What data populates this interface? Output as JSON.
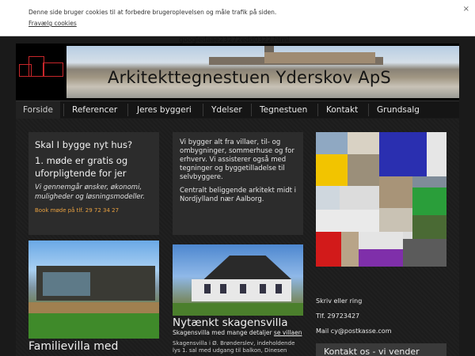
{
  "cookie": {
    "message": "Denne side bruger cookies til at forbedre brugeroplevelsen og måle trafik på siden.",
    "link": "Fravælg cookies",
    "close": "×"
  },
  "google_id": "googledaae23272edd0322.html",
  "header": {
    "title": "Arkitekttegnestuen Yderskov ApS"
  },
  "nav": {
    "items": [
      "Forside",
      "Referencer",
      "Jeres byggeri",
      "Ydelser",
      "Tegnestuen",
      "Kontakt",
      "Grundsalg"
    ]
  },
  "box1": {
    "heading": "Skal I bygge nyt hus?",
    "offer": "1. møde er gratis og uforpligtende for jer",
    "italic": "Vi gennemgår ønsker, økonomi, muligheder og løsningsmodeller.",
    "book": "Book møde på tlf. 29 72 34 27"
  },
  "box2": {
    "p1": "Vi bygger alt fra villaer, til- og ombygninger, sommerhuse og for erhverv. Vi assisterer også med tegninger og byggetilladelse til selvbyggere.",
    "p2": "Centralt beliggende arkitekt midt i Nordjylland nær Aalborg."
  },
  "feature1": {
    "caption": "Familievilla med"
  },
  "feature2": {
    "title": "Nytænkt skagensvilla",
    "subtitle_text": "Skagensvilla med mange detaljer",
    "subtitle_link": "se villaen",
    "body": "Skagensvilla i Ø. Brønderslev, indeholdende lys 1. sal med udgang til balkon, Dinesen"
  },
  "sidebar": {
    "line1": "Skriv eller ring",
    "line2": "Tlf. 29723427",
    "line3": "Mail cy@postkasse.com",
    "box_label": "Kontakt os - vi vender"
  },
  "colors": {
    "accent_orange": "#e8a040",
    "logo_red": "#c8262a",
    "background": "#1a1a1a"
  }
}
